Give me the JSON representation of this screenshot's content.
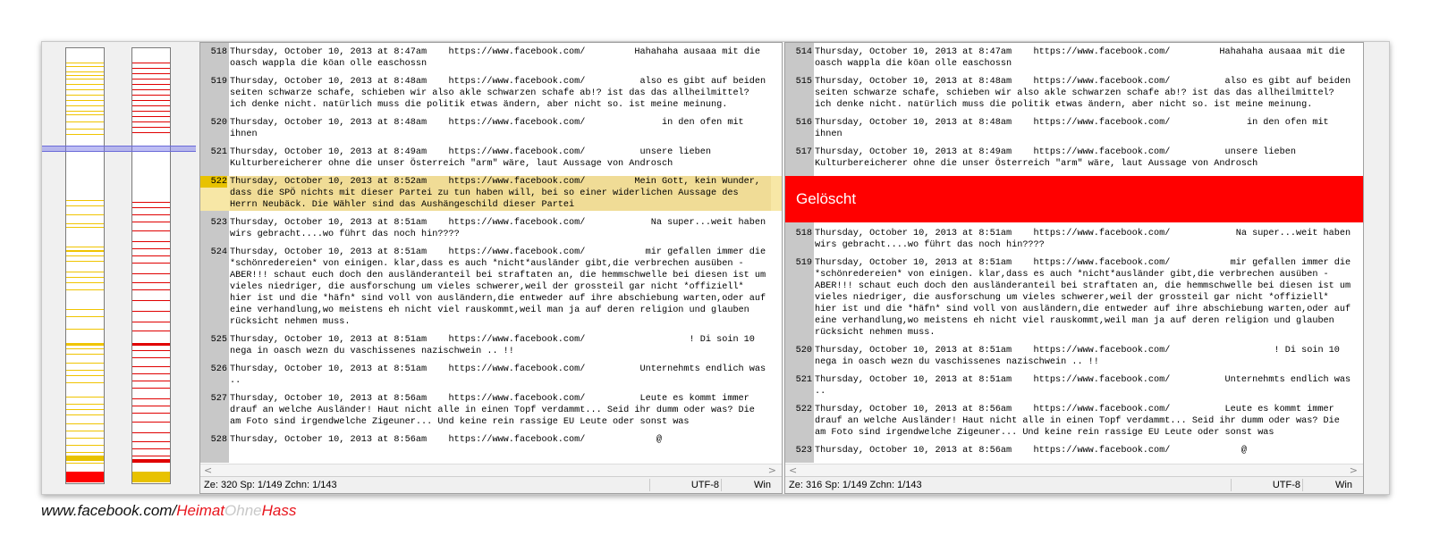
{
  "left_pane": {
    "entries": [
      {
        "num": "518",
        "text": "Thursday, October 10, 2013 at 8:47am    https://www.facebook.com/         Hahahaha ausaaa mit die oasch wappla die köan olle easchossn"
      },
      {
        "num": "519",
        "text": "Thursday, October 10, 2013 at 8:48am    https://www.facebook.com/          also es gibt auf beiden seiten schwarze schafe, schieben wir also akle schwarzen schafe ab!? ist das das allheilmittel? ich denke nicht. natürlich muss die politik etwas ändern, aber nicht so. ist meine meinung."
      },
      {
        "num": "520",
        "text": "Thursday, October 10, 2013 at 8:48am    https://www.facebook.com/              in den ofen mit ihnen"
      },
      {
        "num": "521",
        "text": "Thursday, October 10, 2013 at 8:49am    https://www.facebook.com/          unsere lieben Kulturbereicherer ohne die unser Österreich \"arm\" wäre, laut Aussage von Androsch"
      },
      {
        "num": "522",
        "text": "Thursday, October 10, 2013 at 8:52am    https://www.facebook.com/         Mein Gott, kein Wunder, dass die SPÖ nichts mit dieser Partei zu tun haben will, bei so einer widerlichen Aussage des Herrn Neubäck. Die Wähler sind das Aushängeschild dieser Partei",
        "highlight": true
      },
      {
        "num": "523",
        "text": "Thursday, October 10, 2013 at 8:51am    https://www.facebook.com/            Na super...weit haben wirs gebracht....wo führt das noch hin????"
      },
      {
        "num": "524",
        "text": "Thursday, October 10, 2013 at 8:51am    https://www.facebook.com/           mir gefallen immer die *schönredereien* von einigen. klar,dass es auch *nicht*ausländer gibt,die verbrechen ausüben - ABER!!! schaut euch doch den ausländeranteil bei straftaten an, die hemmschwelle bei diesen ist um vieles niedriger, die ausforschung um vieles schwerer,weil der grossteil gar nicht *offiziell* hier ist und die *häfn* sind voll von ausländern,die entweder auf ihre abschiebung warten,oder auf eine verhandlung,wo meistens eh nicht viel rauskommt,weil man ja auf deren religion und glauben rücksicht nehmen muss."
      },
      {
        "num": "525",
        "text": "Thursday, October 10, 2013 at 8:51am    https://www.facebook.com/                   ! Di soin 10 nega in oasch wezn du vaschissenes nazischwein .. !!"
      },
      {
        "num": "526",
        "text": "Thursday, October 10, 2013 at 8:51am    https://www.facebook.com/          Unternehmts endlich was .."
      },
      {
        "num": "527",
        "text": "Thursday, October 10, 2013 at 8:56am    https://www.facebook.com/          Leute es kommt immer drauf an welche Ausländer! Haut nicht alle in einen Topf verdammt... Seid ihr dumm oder was? Die am Foto sind irgendwelche Zigeuner... Und keine rein rassige EU Leute oder sonst was"
      },
      {
        "num": "528",
        "text": "Thursday, October 10, 2013 at 8:56am    https://www.facebook.com/             @"
      }
    ],
    "status": {
      "position": "Ze: 320  Sp: 1/149  Zchn: 1/143",
      "encoding": "UTF-8",
      "eol": "Win"
    }
  },
  "right_pane": {
    "entries_top": [
      {
        "num": "514",
        "text": "Thursday, October 10, 2013 at 8:47am    https://www.facebook.com/         Hahahaha ausaaa mit die oasch wappla die köan olle easchossn"
      },
      {
        "num": "515",
        "text": "Thursday, October 10, 2013 at 8:48am    https://www.facebook.com/          also es gibt auf beiden seiten schwarze schafe, schieben wir also akle schwarzen schafe ab!? ist das das allheilmittel? ich denke nicht. natürlich muss die politik etwas ändern, aber nicht so. ist meine meinung."
      },
      {
        "num": "516",
        "text": "Thursday, October 10, 2013 at 8:48am    https://www.facebook.com/              in den ofen mit ihnen"
      },
      {
        "num": "517",
        "text": "Thursday, October 10, 2013 at 8:49am    https://www.facebook.com/          unsere lieben Kulturbereicherer ohne die unser Österreich \"arm\" wäre, laut Aussage von Androsch"
      }
    ],
    "deleted_label": "Gelöscht",
    "entries_bottom": [
      {
        "num": "518",
        "text": "Thursday, October 10, 2013 at 8:51am    https://www.facebook.com/            Na super...weit haben wirs gebracht....wo führt das noch hin????"
      },
      {
        "num": "519",
        "text": "Thursday, October 10, 2013 at 8:51am    https://www.facebook.com/           mir gefallen immer die *schönredereien* von einigen. klar,dass es auch *nicht*ausländer gibt,die verbrechen ausüben - ABER!!! schaut euch doch den ausländeranteil bei straftaten an, die hemmschwelle bei diesen ist um vieles niedriger, die ausforschung um vieles schwerer,weil der grossteil gar nicht *offiziell* hier ist und die *häfn* sind voll von ausländern,die entweder auf ihre abschiebung warten,oder auf eine verhandlung,wo meistens eh nicht viel rauskommt,weil man ja auf deren religion und glauben rücksicht nehmen muss."
      },
      {
        "num": "520",
        "text": "Thursday, October 10, 2013 at 8:51am    https://www.facebook.com/                   ! Di soin 10 nega in oasch wezn du vaschissenes nazischwein .. !!"
      },
      {
        "num": "521",
        "text": "Thursday, October 10, 2013 at 8:51am    https://www.facebook.com/          Unternehmts endlich was .."
      },
      {
        "num": "522",
        "text": "Thursday, October 10, 2013 at 8:56am    https://www.facebook.com/          Leute es kommt immer drauf an welche Ausländer! Haut nicht alle in einen Topf verdammt... Seid ihr dumm oder was? Die am Foto sind irgendwelche Zigeuner... Und keine rein rassige EU Leute oder sonst was"
      },
      {
        "num": "523",
        "text": "Thursday, October 10, 2013 at 8:56am    https://www.facebook.com/             @"
      }
    ],
    "status": {
      "position": "Ze: 316  Sp: 1/149  Zchn: 1/143",
      "encoding": "UTF-8",
      "eol": "Win"
    }
  },
  "scroll": {
    "left_arrow": "<",
    "right_arrow": ">"
  },
  "colors": {
    "added": "#e8c200",
    "deleted": "#ff0000",
    "overview_added": "#f0c400",
    "overview_deleted": "#e00000"
  },
  "footer": {
    "part1": "www.facebook.com/",
    "part2": "Heimat",
    "part3": "Ohne",
    "part4": "Hass"
  }
}
